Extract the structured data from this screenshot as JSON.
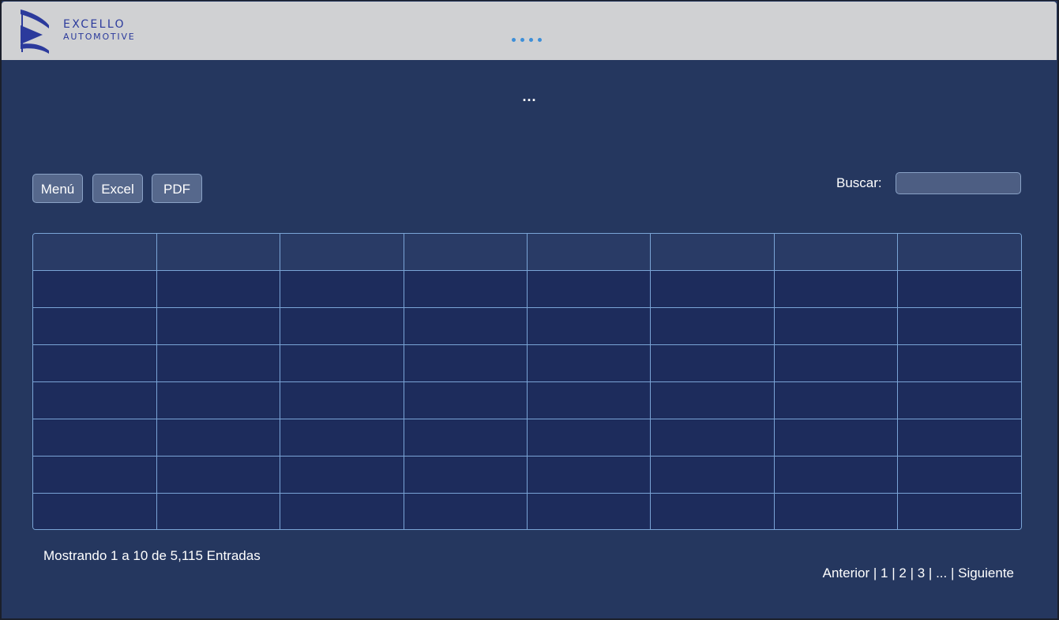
{
  "brand": {
    "name_line1": "EXCELLO",
    "name_line2": "AUTOMOTIVE",
    "logo_icon": "excello-logo-icon",
    "color": "#2b3a9c"
  },
  "header": {
    "loading_indicator": "••••",
    "page_title": "..."
  },
  "toolbar": {
    "menu_label": "Menú",
    "excel_label": "Excel",
    "pdf_label": "PDF"
  },
  "search": {
    "label": "Buscar:",
    "value": "",
    "placeholder": ""
  },
  "table": {
    "columns": [
      "",
      "",
      "",
      "",
      "",
      "",
      "",
      ""
    ],
    "rows": [
      [
        "",
        "",
        "",
        "",
        "",
        "",
        "",
        ""
      ],
      [
        "",
        "",
        "",
        "",
        "",
        "",
        "",
        ""
      ],
      [
        "",
        "",
        "",
        "",
        "",
        "",
        "",
        ""
      ],
      [
        "",
        "",
        "",
        "",
        "",
        "",
        "",
        ""
      ],
      [
        "",
        "",
        "",
        "",
        "",
        "",
        "",
        ""
      ],
      [
        "",
        "",
        "",
        "",
        "",
        "",
        "",
        ""
      ],
      [
        "",
        "",
        "",
        "",
        "",
        "",
        "",
        ""
      ]
    ]
  },
  "footer": {
    "info": "Mostrando 1 a 10 de 5,115 Entradas",
    "pager": {
      "prev": "Anterior",
      "pages": [
        "1",
        "2",
        "3",
        "..."
      ],
      "next": "Siguiente",
      "separator": " | "
    }
  },
  "colors": {
    "background": "#25375f",
    "topbar": "#d0d1d3",
    "grid_line": "#7aa4d6",
    "header_row": "#293b66",
    "body_row": "#1d2c5c",
    "button": "#56688c",
    "loader_dot": "#3d8fd8"
  }
}
